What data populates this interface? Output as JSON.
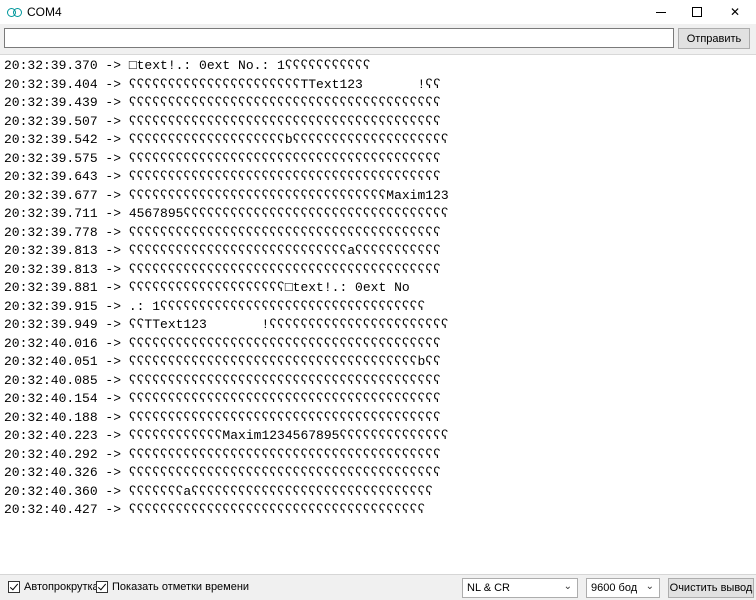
{
  "window": {
    "title": "COM4"
  },
  "send": {
    "input_value": "",
    "button_label": "Отправить"
  },
  "output": {
    "lines": [
      "20:32:39.370 -> □text!.: 0ext No.: 1ʕʕʕʕʕʕʕʕʕʕʕ",
      "20:32:39.404 -> ʕʕʕʕʕʕʕʕʕʕʕʕʕʕʕʕʕʕʕʕʕʕTText123       !ʕʕ",
      "20:32:39.439 -> ʕʕʕʕʕʕʕʕʕʕʕʕʕʕʕʕʕʕʕʕʕʕʕʕʕʕʕʕʕʕʕʕʕʕʕʕʕʕʕʕ",
      "20:32:39.507 -> ʕʕʕʕʕʕʕʕʕʕʕʕʕʕʕʕʕʕʕʕʕʕʕʕʕʕʕʕʕʕʕʕʕʕʕʕʕʕʕʕ",
      "20:32:39.542 -> ʕʕʕʕʕʕʕʕʕʕʕʕʕʕʕʕʕʕʕʕbʕʕʕʕʕʕʕʕʕʕʕʕʕʕʕʕʕʕʕʕ",
      "20:32:39.575 -> ʕʕʕʕʕʕʕʕʕʕʕʕʕʕʕʕʕʕʕʕʕʕʕʕʕʕʕʕʕʕʕʕʕʕʕʕʕʕʕʕ",
      "20:32:39.643 -> ʕʕʕʕʕʕʕʕʕʕʕʕʕʕʕʕʕʕʕʕʕʕʕʕʕʕʕʕʕʕʕʕʕʕʕʕʕʕʕʕ",
      "20:32:39.677 -> ʕʕʕʕʕʕʕʕʕʕʕʕʕʕʕʕʕʕʕʕʕʕʕʕʕʕʕʕʕʕʕʕʕMaxim123",
      "20:32:39.711 -> 4567895ʕʕʕʕʕʕʕʕʕʕʕʕʕʕʕʕʕʕʕʕʕʕʕʕʕʕʕʕʕʕʕʕʕʕ",
      "20:32:39.778 -> ʕʕʕʕʕʕʕʕʕʕʕʕʕʕʕʕʕʕʕʕʕʕʕʕʕʕʕʕʕʕʕʕʕʕʕʕʕʕʕʕ",
      "20:32:39.813 -> ʕʕʕʕʕʕʕʕʕʕʕʕʕʕʕʕʕʕʕʕʕʕʕʕʕʕʕʕaʕʕʕʕʕʕʕʕʕʕʕ",
      "20:32:39.813 -> ʕʕʕʕʕʕʕʕʕʕʕʕʕʕʕʕʕʕʕʕʕʕʕʕʕʕʕʕʕʕʕʕʕʕʕʕʕʕʕʕ",
      "20:32:39.881 -> ʕʕʕʕʕʕʕʕʕʕʕʕʕʕʕʕʕʕʕʕ□text!.: 0ext No",
      "20:32:39.915 -> .: 1ʕʕʕʕʕʕʕʕʕʕʕʕʕʕʕʕʕʕʕʕʕʕʕʕʕʕʕʕʕʕʕʕʕʕ",
      "20:32:39.949 -> ʕʕTText123       !ʕʕʕʕʕʕʕʕʕʕʕʕʕʕʕʕʕʕʕʕʕʕʕ",
      "20:32:40.016 -> ʕʕʕʕʕʕʕʕʕʕʕʕʕʕʕʕʕʕʕʕʕʕʕʕʕʕʕʕʕʕʕʕʕʕʕʕʕʕʕʕ",
      "20:32:40.051 -> ʕʕʕʕʕʕʕʕʕʕʕʕʕʕʕʕʕʕʕʕʕʕʕʕʕʕʕʕʕʕʕʕʕʕʕʕʕbʕʕ",
      "20:32:40.085 -> ʕʕʕʕʕʕʕʕʕʕʕʕʕʕʕʕʕʕʕʕʕʕʕʕʕʕʕʕʕʕʕʕʕʕʕʕʕʕʕʕ",
      "20:32:40.154 -> ʕʕʕʕʕʕʕʕʕʕʕʕʕʕʕʕʕʕʕʕʕʕʕʕʕʕʕʕʕʕʕʕʕʕʕʕʕʕʕʕ",
      "20:32:40.188 -> ʕʕʕʕʕʕʕʕʕʕʕʕʕʕʕʕʕʕʕʕʕʕʕʕʕʕʕʕʕʕʕʕʕʕʕʕʕʕʕʕ",
      "20:32:40.223 -> ʕʕʕʕʕʕʕʕʕʕʕʕMaxim1234567895ʕʕʕʕʕʕʕʕʕʕʕʕʕʕ",
      "20:32:40.292 -> ʕʕʕʕʕʕʕʕʕʕʕʕʕʕʕʕʕʕʕʕʕʕʕʕʕʕʕʕʕʕʕʕʕʕʕʕʕʕʕʕ",
      "20:32:40.326 -> ʕʕʕʕʕʕʕʕʕʕʕʕʕʕʕʕʕʕʕʕʕʕʕʕʕʕʕʕʕʕʕʕʕʕʕʕʕʕʕʕ",
      "20:32:40.360 -> ʕʕʕʕʕʕʕaʕʕʕʕʕʕʕʕʕʕʕʕʕʕʕʕʕʕʕʕʕʕʕʕʕʕʕʕʕʕʕ",
      "20:32:40.427 -> ʕʕʕʕʕʕʕʕʕʕʕʕʕʕʕʕʕʕʕʕʕʕʕʕʕʕʕʕʕʕʕʕʕʕʕʕʕʕ"
    ]
  },
  "footer": {
    "autoscroll_label": "Автопрокрутка",
    "timestamps_label": "Показать отметки времени",
    "line_ending": "NL & CR",
    "baud": "9600 бод",
    "clear_label": "Очистить вывод"
  },
  "icons": {
    "app": "arduino-icon",
    "minimize": "minimize-icon",
    "maximize": "maximize-icon",
    "close": "close-icon",
    "dropdown": "chevron-down-icon",
    "check": "checkmark-icon"
  },
  "colors": {
    "accent": "#00979c"
  }
}
